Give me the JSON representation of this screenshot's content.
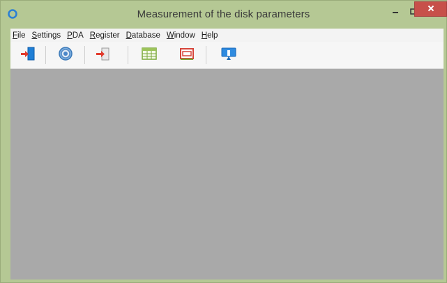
{
  "window": {
    "title": "Measurement of the disk parameters",
    "app_icon": "app-logo-icon",
    "controls": {
      "minimize_icon": "minimize-icon",
      "maximize_icon": "maximize-icon",
      "close_icon": "close-icon"
    }
  },
  "menu": {
    "items": [
      {
        "accel": "F",
        "rest": "ile"
      },
      {
        "accel": "S",
        "rest": "ettings"
      },
      {
        "accel": "P",
        "rest": "DA"
      },
      {
        "accel": "R",
        "rest": "egister"
      },
      {
        "accel": "D",
        "rest": "atabase"
      },
      {
        "accel": "W",
        "rest": "indow"
      },
      {
        "accel": "H",
        "rest": "elp"
      }
    ]
  },
  "toolbar": {
    "buttons": [
      {
        "icon": "exit-door-icon"
      },
      {
        "icon": "settings-gear-icon"
      },
      {
        "icon": "import-arrow-icon"
      },
      {
        "icon": "table-grid-icon"
      },
      {
        "icon": "chart-window-icon"
      },
      {
        "icon": "info-monitor-icon"
      }
    ]
  },
  "colors": {
    "titlebar": "#b5c894",
    "close_button": "#c7504a",
    "client_area": "#a9a9a9",
    "toolbar": "#f6f6f6"
  }
}
